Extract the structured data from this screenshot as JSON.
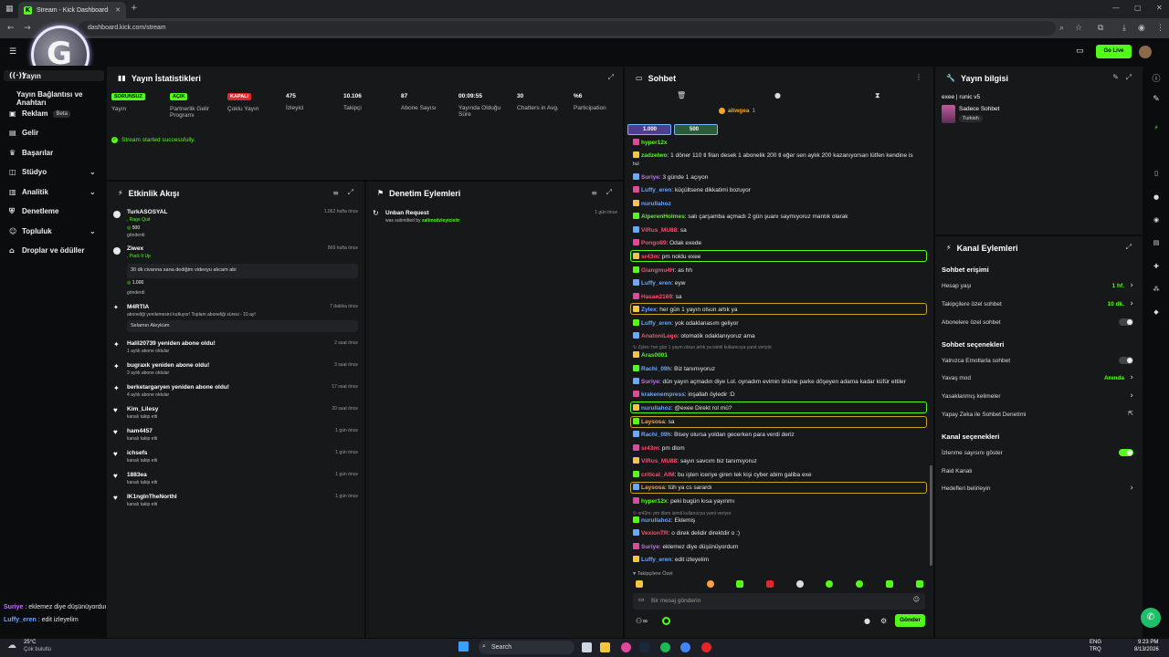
{
  "browser": {
    "tab_title": "Stream - Kick Dashboard",
    "url": "dashboard.kick.com/stream"
  },
  "topnav": {
    "go_live": "Go Live"
  },
  "sidebar": {
    "items": [
      {
        "label": "Yayın",
        "icon": "broadcast-icon"
      },
      {
        "label": "Yayın Bağlantısı ve Anahtarı"
      },
      {
        "label": "Reklam",
        "badge": "Beta",
        "icon": "ad-icon"
      },
      {
        "label": "Gelir",
        "icon": "money-icon"
      },
      {
        "label": "Başarılar",
        "icon": "trophy-icon"
      },
      {
        "label": "Stüdyo",
        "icon": "studio-icon"
      },
      {
        "label": "Analitik",
        "icon": "chart-icon"
      },
      {
        "label": "Denetleme",
        "icon": "shield-icon"
      },
      {
        "label": "Topluluk",
        "icon": "community-icon"
      },
      {
        "label": "Droplar ve ödüller",
        "icon": "gift-icon"
      }
    ]
  },
  "stats": {
    "title": "Yayın İstatistikleri",
    "items": [
      {
        "value": "SORUNSUZ",
        "label": "Yayın",
        "tag_color": "#53fc18"
      },
      {
        "value": "AÇIK",
        "label": "Partnerlik Gelir Programı",
        "tag_color": "#53fc18"
      },
      {
        "value": "KAPALI",
        "label": "Çoklu Yayın",
        "tag_color": "#e3262a"
      },
      {
        "value": "475",
        "label": "İzleyici"
      },
      {
        "value": "10.106",
        "label": "Takipçi"
      },
      {
        "value": "87",
        "label": "Abone Sayısı"
      },
      {
        "value": "00:09:55",
        "label": "Yayında Olduğu Süre"
      },
      {
        "value": "30",
        "label": "Chatters in Avg."
      },
      {
        "value": "%6",
        "label": "Participation"
      }
    ],
    "status": "Stream started successfully."
  },
  "activity": {
    "title": "Etkinlik Akışı",
    "items": [
      {
        "name": "TurkASOSYAL",
        "sub": ", Rage Quit",
        "sub2": "500",
        "sub3": "gönderdi",
        "time": "1.062 hafta önce"
      },
      {
        "name": "Ziwex",
        "sub": ", Pack It Up",
        "msg": "30 dk civarına sana dediğim videoyu alıcam abi",
        "sub2": "1.000",
        "sub3": "gönderdi",
        "time": "869 hafta önce"
      },
      {
        "name": "M4RTIA",
        "sub": "aboneliği yenilemesini kutluyor! Toplam aboneliği süresi - 10 ay!",
        "msg": "Selamın Aleyküm",
        "time": "7 dakika önce"
      },
      {
        "name": "Halil20739 yeniden abone oldu!",
        "sub": "1 aylık abone oldular",
        "time": "2 saat önce"
      },
      {
        "name": "bugraxk yeniden abone oldu!",
        "sub": "3 aylık abone oldular",
        "time": "3 saat önce"
      },
      {
        "name": "berketargaryen yeniden abone oldu!",
        "sub": "4 aylık abone oldular",
        "time": "17 saat önce"
      },
      {
        "name": "Kim_Lilesy",
        "sub": "kanalı takip etti",
        "time": "20 saat önce"
      },
      {
        "name": "ham4457",
        "sub": "kanalı takip etti",
        "time": "1 gün önce"
      },
      {
        "name": "ichsefs",
        "sub": "kanalı takip etti",
        "time": "1 gün önce"
      },
      {
        "name": "1883ea",
        "sub": "kanalı takip etti",
        "time": "1 gün önce"
      },
      {
        "name": "IK1ngInTheNorthI",
        "sub": "kanalı takip etti",
        "time": "1 gün önce"
      }
    ]
  },
  "moderation": {
    "title": "Denetim Eylemleri",
    "item_title": "Unban Request",
    "item_sub": "was submitted by",
    "item_user": "zalimotizleyicisitr",
    "item_time": "1 gün önce"
  },
  "chat": {
    "title": "Sohbet",
    "pinned_user": "aliwgea",
    "pinned_count": "1",
    "goal1": "1.000",
    "goal2": "500",
    "lines": [
      {
        "user": "hyper12x",
        "msg": "",
        "color": "#53fc18"
      },
      {
        "user": "zadzelwo",
        "msg": "1 döner 110 tl filan desek 1 abonelik 200 tl eğer sen aylık 200 kazanıyorsan lütfen kendine is",
        "color": "#53fc18"
      },
      {
        "user": "",
        "msg": "bul",
        "color": "#ddd"
      },
      {
        "user": "Suriye",
        "msg": "3 günde 1 açıyon",
        "color": "#c86dff"
      },
      {
        "user": "Luffy_eren",
        "msg": "küçültsene dikkatimi bozuyor",
        "color": "#6aa7ff"
      },
      {
        "user": "nurullahoz",
        "msg": "",
        "color": "#6aa7ff"
      },
      {
        "user": "AlperenHolmes",
        "msg": "salı çarşamba açmadı 2 gün şuanı saymıyoruz mantık olarak",
        "color": "#53fc18"
      },
      {
        "user": "ViRus_MU88",
        "msg": "sa",
        "color": "#ff4d6d"
      },
      {
        "user": "Pongo89",
        "msg": "Odak exede",
        "color": "#ff4d6d"
      },
      {
        "user": "sr43m",
        "msg": "pm noldu exee",
        "color": "#ff4d6d"
      },
      {
        "user": "Giangmu4H",
        "msg": "as hh",
        "color": "#ff4d6d"
      },
      {
        "user": "Luffy_eren",
        "msg": "eyw",
        "color": "#6aa7ff"
      },
      {
        "user": "Hasan2169",
        "msg": "sa",
        "color": "#ff4d6d"
      },
      {
        "user": "Zylex",
        "msg": "her gün 1 yayın olsun artık ya",
        "color": "#6aa7ff"
      },
      {
        "user": "Luffy_eren",
        "msg": "yok odaklanasım geliyor",
        "color": "#6aa7ff"
      },
      {
        "user": "AnatoniLego",
        "msg": "otomatik odaklanıyoruz ama",
        "color": "#ff4d6d"
      },
      {
        "user": "",
        "msg": "↻ Zylex: her gün 1 yayın olsun artık ya isimli kullanıcıya yanıt veriyor",
        "color": "#888"
      },
      {
        "user": "Aras0001",
        "msg": "",
        "color": "#53fc18"
      },
      {
        "user": "Rachi_09h",
        "msg": "Biz tanımıyoruz",
        "color": "#6aa7ff"
      },
      {
        "user": "Suriye",
        "msg": "dün yayın açmadın diye Lol. oynadım evimin önüne parke döşeyen adama kadar küfür ettiler",
        "color": "#c86dff"
      },
      {
        "user": "krakenempress",
        "msg": "inşallah öyledir :D",
        "color": "#6aa7ff"
      },
      {
        "user": "nurullahoz",
        "msg": "@exee Direkt rol mü?",
        "color": "#6aa7ff"
      },
      {
        "user": "Laysosa",
        "msg": "sa",
        "color": "#ff9f43"
      },
      {
        "user": "Rachi_09h",
        "msg": "Bisey olursa yoldan gecerken para verdi deriz",
        "color": "#6aa7ff"
      },
      {
        "user": "sr43m",
        "msg": "pm dlom",
        "color": "#ff4d6d"
      },
      {
        "user": "ViRus_MU88",
        "msg": "sayın savcım biz tanımıyoruz",
        "color": "#ff4d6d"
      },
      {
        "user": "critical_AIM",
        "msg": "bu işten iceriye giren tek kişi cyber abim galiba exe",
        "color": "#ff4d6d"
      },
      {
        "user": "Laysosa",
        "msg": "tüh ya cs sarardı",
        "color": "#ff9f43"
      },
      {
        "user": "hyper12x",
        "msg": "peki bugün kısa yayınmı",
        "color": "#53fc18"
      },
      {
        "user": "",
        "msg": "↻ sr43m: pm dlom isimli kullanıcıya yanıt veriyor",
        "color": "#888"
      },
      {
        "user": "nurullahoz",
        "msg": "Eklemiş",
        "color": "#6aa7ff"
      },
      {
        "user": "VexionTR",
        "msg": "o direk delidir direktdir o :)",
        "color": "#ff4d6d"
      },
      {
        "user": "Suriye",
        "msg": "eklemez diye düşünüyordum",
        "color": "#c86dff"
      },
      {
        "user": "Luffy_eren",
        "msg": "edit izleyelim",
        "color": "#6aa7ff"
      }
    ],
    "followers_only": "♥ Takipçilere Özel",
    "input_placeholder": "Bir mesaj gönderin",
    "send": "Gönder"
  },
  "stream_info": {
    "title": "Yayın bilgisi",
    "stream_title": "exee | runic v5",
    "category": "Sadece Sohbet",
    "language": "Turkish"
  },
  "channel_actions": {
    "title": "Kanal Eylemleri",
    "chat_access": "Sohbet erişimi",
    "account_age": "Hesap yaşı",
    "account_age_val": "1 hf.",
    "followers_only": "Takipçilere özel sohbet",
    "followers_only_val": "10 dk.",
    "subs_only": "Abonelere özel sohbet",
    "chat_options": "Sohbet seçenekleri",
    "emotes_only": "Yalnızca Emotlarla sohbet",
    "slow_mode": "Yavaş mod",
    "slow_mode_val": "Anında",
    "banned_words": "Yasaklanmış kelimeler",
    "ai_mod": "Yapay Zeka ile Sohbet Denetimi",
    "channel_options": "Kanal seçenekleri",
    "viewer_count": "İzlenme sayısını göster",
    "raid": "Raid Kanalı",
    "goals": "Hedefleri belirleyin"
  },
  "overlay_chat": [
    {
      "user": "Suriye",
      "msg": "eklemez diye düşünüyordum"
    },
    {
      "user": "Luffy_eren",
      "msg": "edit izleyelim"
    }
  ],
  "taskbar": {
    "weather_temp": "25°C",
    "weather_desc": "Çok bulutlu",
    "search": "Search",
    "time": "9:23 PM",
    "date": "8/13/2026",
    "lang": "ENG",
    "lang2": "TRQ"
  }
}
